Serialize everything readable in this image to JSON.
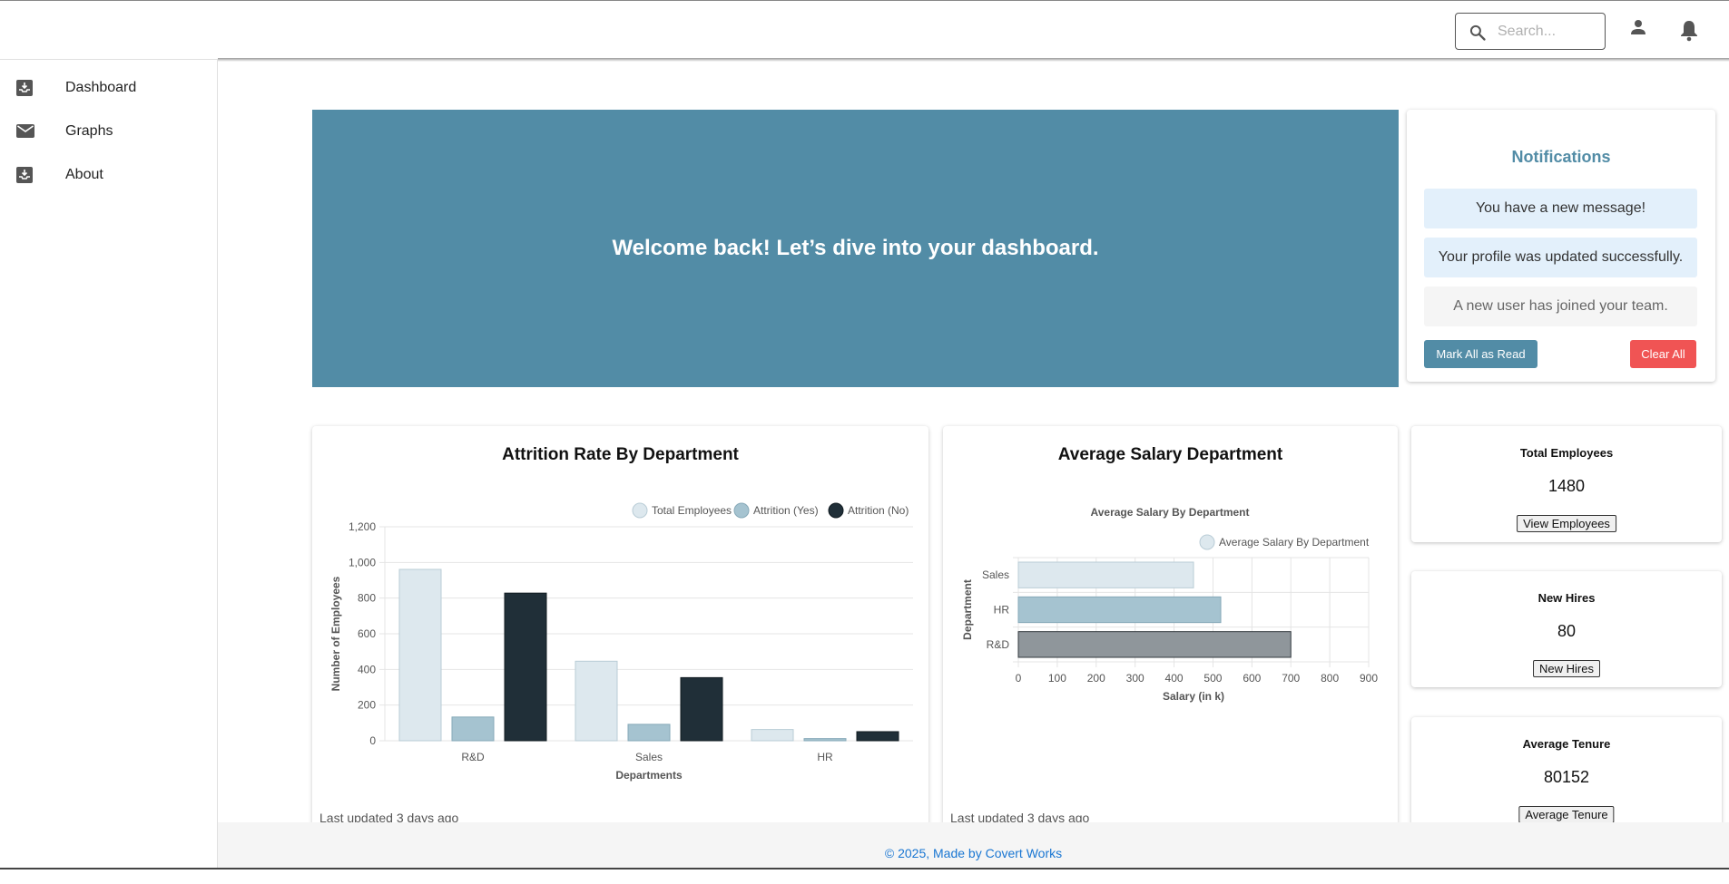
{
  "header": {
    "search_placeholder": "Search...",
    "icons": [
      "search-icon",
      "account-icon",
      "bell-icon"
    ]
  },
  "sidebar": {
    "items": [
      {
        "label": "Dashboard",
        "icon": "inbox-icon"
      },
      {
        "label": "Graphs",
        "icon": "mail-icon"
      },
      {
        "label": "About",
        "icon": "inbox-icon"
      }
    ]
  },
  "welcome": {
    "message": "Welcome back! Let’s dive into your dashboard."
  },
  "notifications": {
    "title": "Notifications",
    "messages": [
      {
        "text": "You have a new message!",
        "status": "unread"
      },
      {
        "text": "Your profile was updated successfully.",
        "status": "unread"
      },
      {
        "text": "A new user has joined your team.",
        "status": "read"
      }
    ],
    "mark_all_label": "Mark All as Read",
    "clear_all_label": "Clear All"
  },
  "attrition_card": {
    "title": "Attrition Rate By Department",
    "footer": "Last updated 3 days ago"
  },
  "salary_card": {
    "title": "Average Salary Department",
    "footer": "Last updated 3 days ago"
  },
  "stats": [
    {
      "title": "Total Employees",
      "value": "1480",
      "button": "View Employees"
    },
    {
      "title": "New Hires",
      "value": "80",
      "button": "New Hires"
    },
    {
      "title": "Average Tenure",
      "value": "80152",
      "button": "Average Tenure"
    }
  ],
  "footer": {
    "text": "© 2025, Made by Covert Works"
  },
  "chart_data": [
    {
      "type": "bar",
      "orientation": "vertical",
      "categories": [
        "R&D",
        "Sales",
        "HR"
      ],
      "series": [
        {
          "name": "Total Employees",
          "values": [
            961,
            446,
            63
          ],
          "color": "#dde8ee"
        },
        {
          "name": "Attrition (Yes)",
          "values": [
            133,
            92,
            12
          ],
          "color": "#a5c3d0"
        },
        {
          "name": "Attrition (No)",
          "values": [
            828,
            354,
            51
          ],
          "color": "#202f38"
        }
      ],
      "xlabel": "Departments",
      "ylabel": "Number of Employees",
      "ylim": [
        0,
        1200
      ],
      "yticks": [
        0,
        200,
        400,
        600,
        800,
        1000,
        1200
      ],
      "ytick_labels": [
        "0",
        "200",
        "400",
        "600",
        "800",
        "1,000",
        "1,200"
      ],
      "legend": "top-right",
      "grid": true
    },
    {
      "type": "bar",
      "orientation": "horizontal",
      "title": "Average Salary By Department",
      "categories": [
        "Sales",
        "HR",
        "R&D"
      ],
      "series": [
        {
          "name": "Average Salary By Department",
          "values": [
            450,
            520,
            700
          ]
        }
      ],
      "bar_colors": [
        "#dde8ee",
        "#a5c3d0",
        "#8f969b"
      ],
      "xlabel": "Salary (in k)",
      "ylabel": "Department",
      "xlim": [
        0,
        900
      ],
      "xticks": [
        0,
        100,
        200,
        300,
        400,
        500,
        600,
        700,
        800,
        900
      ],
      "legend": "top-right",
      "grid": true
    }
  ]
}
